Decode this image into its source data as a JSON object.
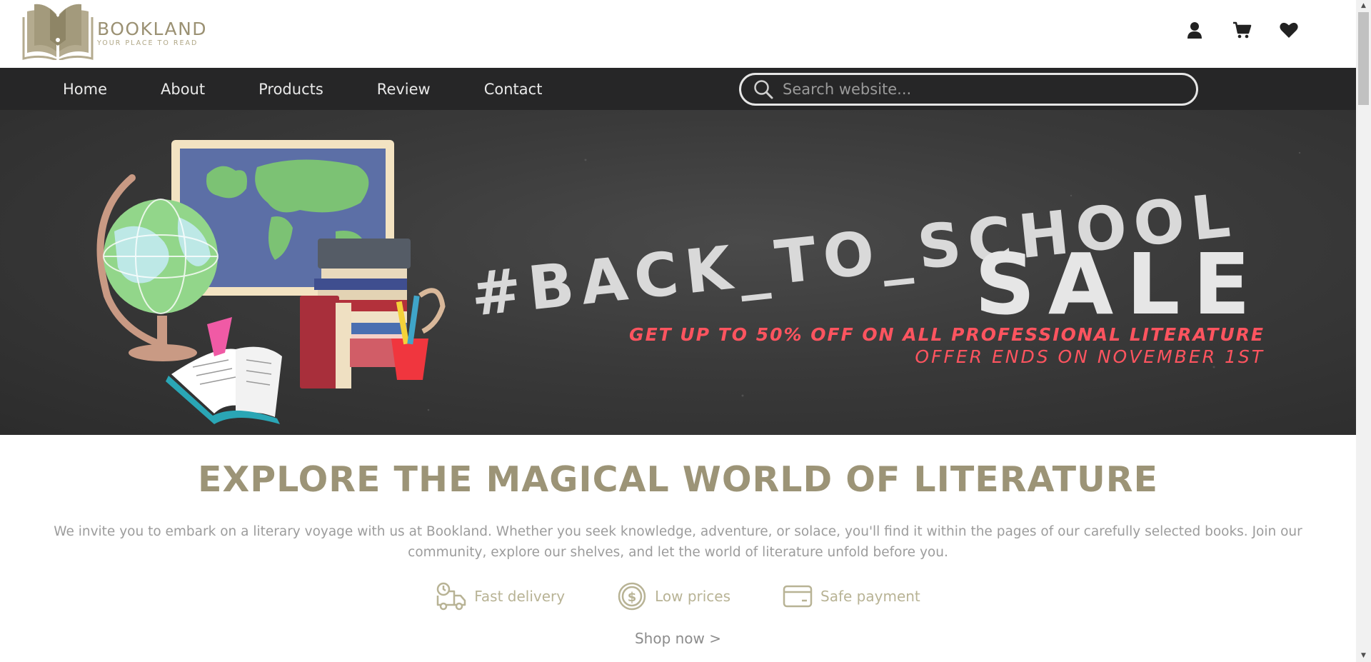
{
  "brand": {
    "name": "BOOKLAND",
    "tagline": "YOUR PLACE TO READ",
    "color": "#9b9173"
  },
  "header_icons": [
    "user-icon",
    "cart-icon",
    "heart-icon"
  ],
  "nav": {
    "items": [
      {
        "label": "Home"
      },
      {
        "label": "About"
      },
      {
        "label": "Products"
      },
      {
        "label": "Review"
      },
      {
        "label": "Contact"
      }
    ],
    "search_placeholder": "Search website..."
  },
  "banner": {
    "hashtag": "#BACK_TO_SCHOOL",
    "sale": "SALE",
    "promo_line1": "GET UP TO 50% OFF ON ALL PROFESSIONAL LITERATURE",
    "promo_line2": "OFFER ENDS ON NOVEMBER 1ST",
    "accent_color": "#ff545f"
  },
  "main": {
    "headline": "EXPLORE THE MAGICAL WORLD OF LITERATURE",
    "intro": "We invite you to embark on a literary voyage with us at Bookland. Whether you seek knowledge, adventure, or solace, you'll find it within the pages of our carefully selected books. Join our community, explore our shelves, and let the world of literature unfold before you.",
    "features": [
      {
        "icon": "delivery-truck-icon",
        "label": "Fast delivery"
      },
      {
        "icon": "coin-dollar-icon",
        "label": "Low prices"
      },
      {
        "icon": "credit-card-icon",
        "label": "Safe payment"
      }
    ],
    "cta": "Shop now >"
  }
}
